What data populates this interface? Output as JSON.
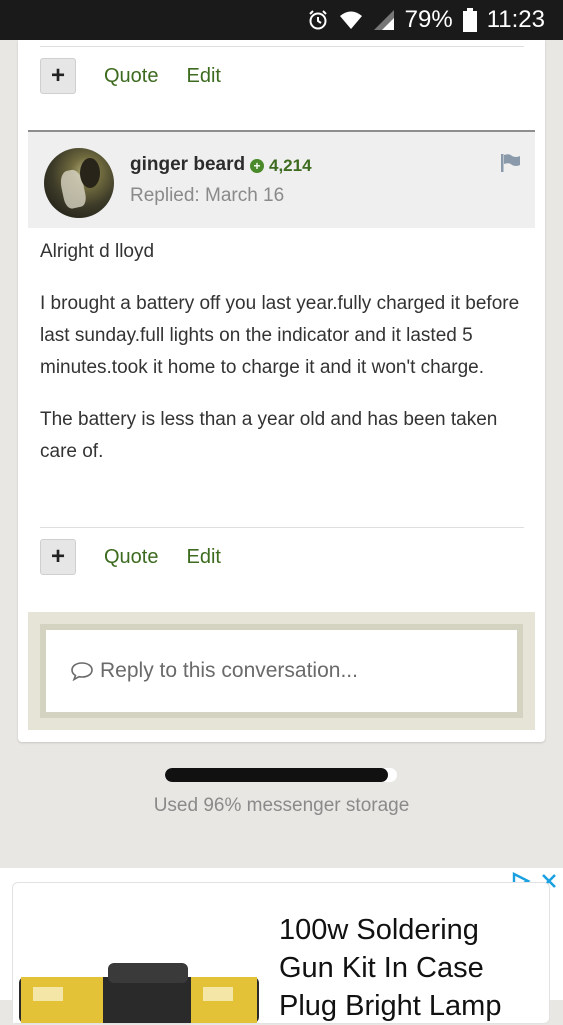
{
  "status_bar": {
    "battery_percent": "79%",
    "time": "11:23",
    "icons": [
      "alarm-icon",
      "wifi-icon",
      "signal-icon",
      "battery-icon"
    ]
  },
  "top_actions": {
    "plus_label": "+",
    "quote_label": "Quote",
    "edit_label": "Edit"
  },
  "post": {
    "author": "ginger beard",
    "reputation": "4,214",
    "replied": "Replied: March 16",
    "paragraphs": [
      "Alright d lloyd",
      "I brought a battery off you last year.fully charged it before last sunday.full lights on the indicator and it lasted 5 minutes.took it home to charge it and it won't charge.",
      "The battery is less than a year old and has been taken care of."
    ]
  },
  "bottom_actions": {
    "plus_label": "+",
    "quote_label": "Quote",
    "edit_label": "Edit"
  },
  "reply": {
    "placeholder": "Reply to this conversation..."
  },
  "storage": {
    "used_fraction": 0.96,
    "text": "Used 96% messenger storage"
  },
  "ad": {
    "title": "100w Soldering Gun Kit In Case Plug Bright Lamp"
  },
  "colors": {
    "accent_green": "#3d6b1f",
    "page_bg": "#e9e7e3",
    "ad_blue": "#1aa0e0"
  }
}
